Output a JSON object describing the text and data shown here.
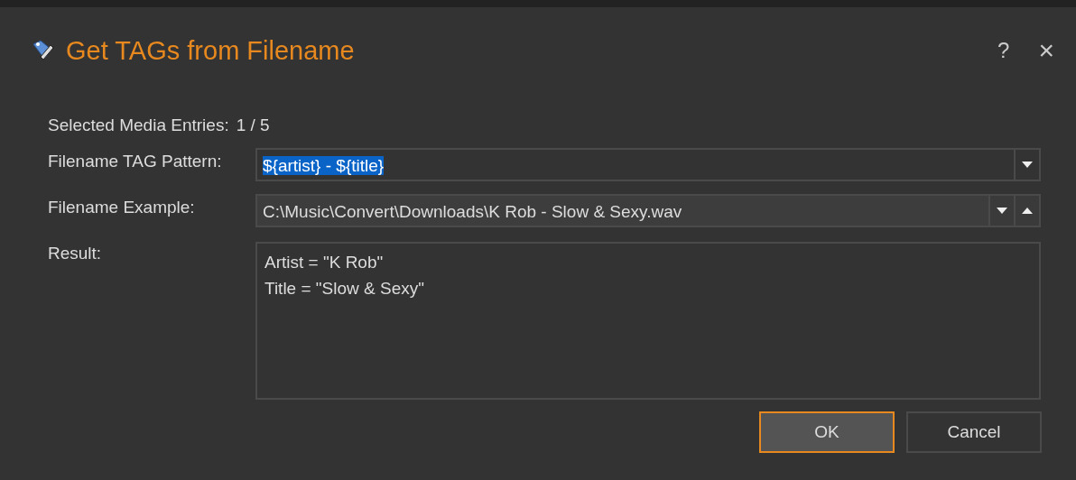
{
  "window": {
    "title": "Get TAGs from Filename",
    "help": "?",
    "close": "×"
  },
  "selected_entries": {
    "label": "Selected Media Entries:",
    "value": "1 / 5"
  },
  "pattern": {
    "label": "Filename TAG Pattern:",
    "value": "${artist} - ${title}",
    "text_selected": true
  },
  "example": {
    "label": "Filename Example:",
    "value": "C:\\Music\\Convert\\Downloads\\K Rob - Slow & Sexy.wav"
  },
  "result": {
    "label": "Result:",
    "lines": [
      "Artist = \"K Rob\"",
      "Title = \"Slow & Sexy\""
    ]
  },
  "buttons": [
    {
      "label": "OK",
      "default": true
    },
    {
      "label": "Cancel",
      "default": false
    }
  ]
}
